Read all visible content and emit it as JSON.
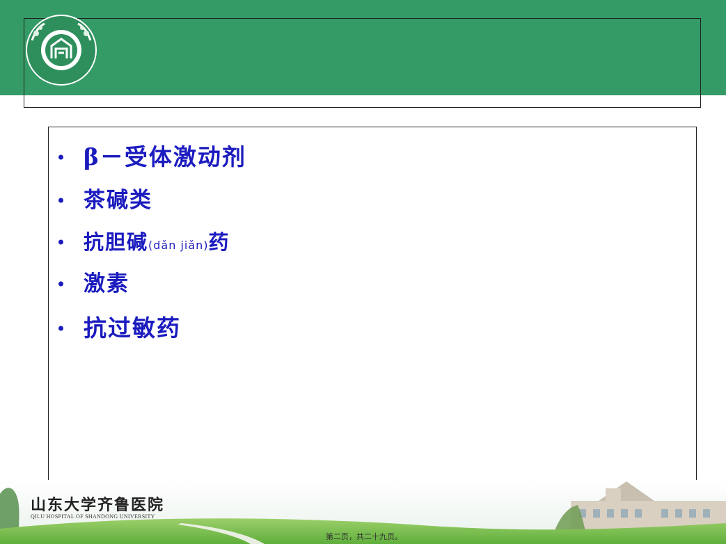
{
  "slide": {
    "title": "",
    "bullets": [
      {
        "prefix": "β",
        "text": "－受体激动剂"
      },
      {
        "text": "茶碱类"
      },
      {
        "text_main": "抗胆碱",
        "pinyin": "(dǎn jiǎn)",
        "text_end": "药"
      },
      {
        "text": "激素"
      },
      {
        "text": "抗过敏药"
      }
    ]
  },
  "logo": {
    "ring_text": "QILU HOSPITAL OF SHANDONG UNIVERSITY",
    "chinese": "山东大学齐鲁医院"
  },
  "footer": {
    "brand": "山东大学齐鲁医院",
    "brand_sub": "QILU HOSPITAL OF SHANDONG UNIVERSITY",
    "page_number": "第二页，共二十九页。"
  },
  "colors": {
    "band": "#349a66",
    "bullet_text": "#1b1bbf"
  }
}
